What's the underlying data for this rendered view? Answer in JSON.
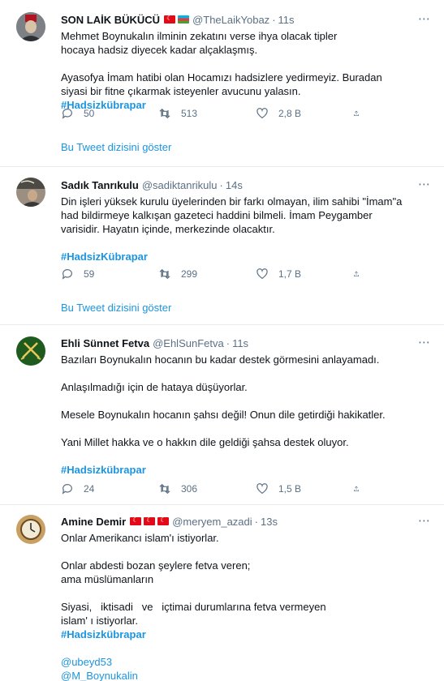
{
  "tweets": [
    {
      "name": "SON LAİK BÜKÜCÜ",
      "handle": "@TheLaikYobaz",
      "time": "11s",
      "p1": "Mehmet Boynukalın ilminin zekatını verse ihya olacak tipler hocaya hadsiz diyecek kadar alçaklaşmış.",
      "p2_text": "Ayasofya İmam hatibi olan Hocamızı hadsizlere yedirmeyiz. Buradan siyasi bir fitne çıkarmak isteyenler avucunu yalasın. ",
      "hashtag": "#Hadsizkübrapar",
      "replies": "50",
      "retweets": "513",
      "likes": "2,8 B",
      "thread_link": "Bu Tweet dizisini göster"
    },
    {
      "name": "Sadık Tanrıkulu",
      "handle": "@sadiktanrikulu",
      "time": "14s",
      "p1": "Din işleri yüksek kurulu üyelerinden bir farkı olmayan, ilim sahibi \"İmam\"a had bildirmeye kalkışan gazeteci haddini bilmeli. İmam Peygamber varisidir. Hayatın içinde, merkezinde olacaktır.",
      "hashtag": "#HadsizKübrapar",
      "replies": "59",
      "retweets": "299",
      "likes": "1,7 B",
      "thread_link": "Bu Tweet dizisini göster"
    },
    {
      "name": "Ehli Sünnet Fetva",
      "handle": "@EhlSunFetva",
      "time": "11s",
      "p1": "Bazıları Boynukalın hocanın bu kadar destek görmesini anlayamadı.",
      "p2": "Anlaşılmadığı için de hataya düşüyorlar.",
      "p3": "Mesele Boynukalın hocanın şahsı değil! Onun dile getirdiği hakikatler.",
      "p4": "Yani Millet hakka ve o hakkın dile geldiği şahsa destek oluyor.",
      "hashtag": "#Hadsizkübrapar",
      "replies": "24",
      "retweets": "306",
      "likes": "1,5 B"
    },
    {
      "name": "Amine Demir",
      "handle": "@meryem_azadi",
      "time": "13s",
      "p1": "Onlar Amerikancı islam'ı istiyorlar.",
      "p2a": "Onlar abdesti bozan şeylere fetva veren;",
      "p2b": "ama müslümanların",
      "p3a": "Siyasi,   iktisadi   ve   içtimai durumlarına fetva vermeyen",
      "p3b": "islam' ı istiyorlar.",
      "hashtag": "#Hadsizkübrapar",
      "mention1": "@ubeyd53",
      "mention2": "@M_Boynukalin"
    }
  ],
  "more_icon": "⋯",
  "colors": {
    "link": "#1b95e0",
    "muted": "#5b7083",
    "divider": "#e6ecf0"
  }
}
